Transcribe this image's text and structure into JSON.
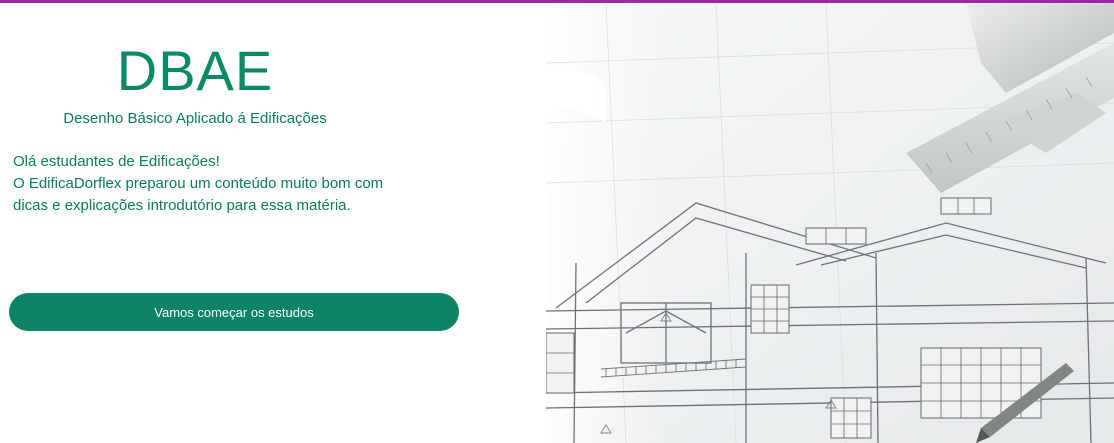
{
  "header": {
    "logo_text": "DBAE",
    "subtitle": "Desenho Básico Aplicado á Edificações"
  },
  "intro": {
    "line1": "Olá estudantes de Edificações!",
    "line2": "O EdificaDorflex  preparou um conteúdo muito bom com dicas e explicações introdutório para essa matéria."
  },
  "cta": {
    "label": "Vamos começar os estudos"
  },
  "colors": {
    "accent": "#0d8467",
    "text": "#0b7a62",
    "top_border": "#9b2aa0"
  },
  "hero_image": {
    "icon": "architectural-blueprint-image"
  }
}
